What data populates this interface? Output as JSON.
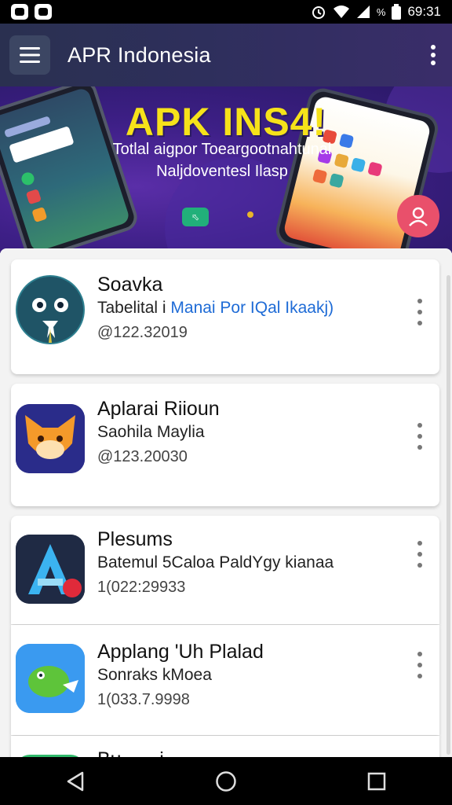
{
  "status_bar": {
    "time": "69:31",
    "battery_percent": "%"
  },
  "app_bar": {
    "title": "APR Indonesia"
  },
  "banner": {
    "headline": "APK INS4!",
    "subline_1": "Totlal aigpor Toeargootnahtunal",
    "subline_2": "Naljdoventesl Ilasp",
    "pill_label": "⬁"
  },
  "apps": [
    {
      "name": "Soavka",
      "desc_prefix": "Tabelital i ",
      "desc_highlight": "Manai Por IQal Ikaakj)",
      "meta": "@122.32019",
      "icon": "blue-owl-icon"
    },
    {
      "name": "Aplarai Riioun",
      "desc_prefix": "Saohila Maylia",
      "desc_highlight": "",
      "meta": "@123.20030",
      "icon": "orange-fox-icon"
    },
    {
      "name": "Plesums",
      "desc_prefix": "Batemul 5Caloa PaldYgy kianaa",
      "desc_highlight": "",
      "meta": "1(022:29933",
      "icon": "letter-a-icon"
    },
    {
      "name": "Applang 'Uh Plalad",
      "desc_prefix": "Sonraks kMoea",
      "desc_highlight": "",
      "meta": "1(033.7.9998",
      "icon": "green-bird-icon"
    },
    {
      "name": "Bu... ...i...",
      "desc_prefix": "",
      "desc_highlight": "",
      "meta": "",
      "icon": "green-app-icon"
    }
  ],
  "colors": {
    "app_bar": "#2e2f5c",
    "banner": "#3d1f86",
    "headline": "#f6e21a",
    "accent_link": "#1e6bd6",
    "fab": "#e9506b"
  }
}
